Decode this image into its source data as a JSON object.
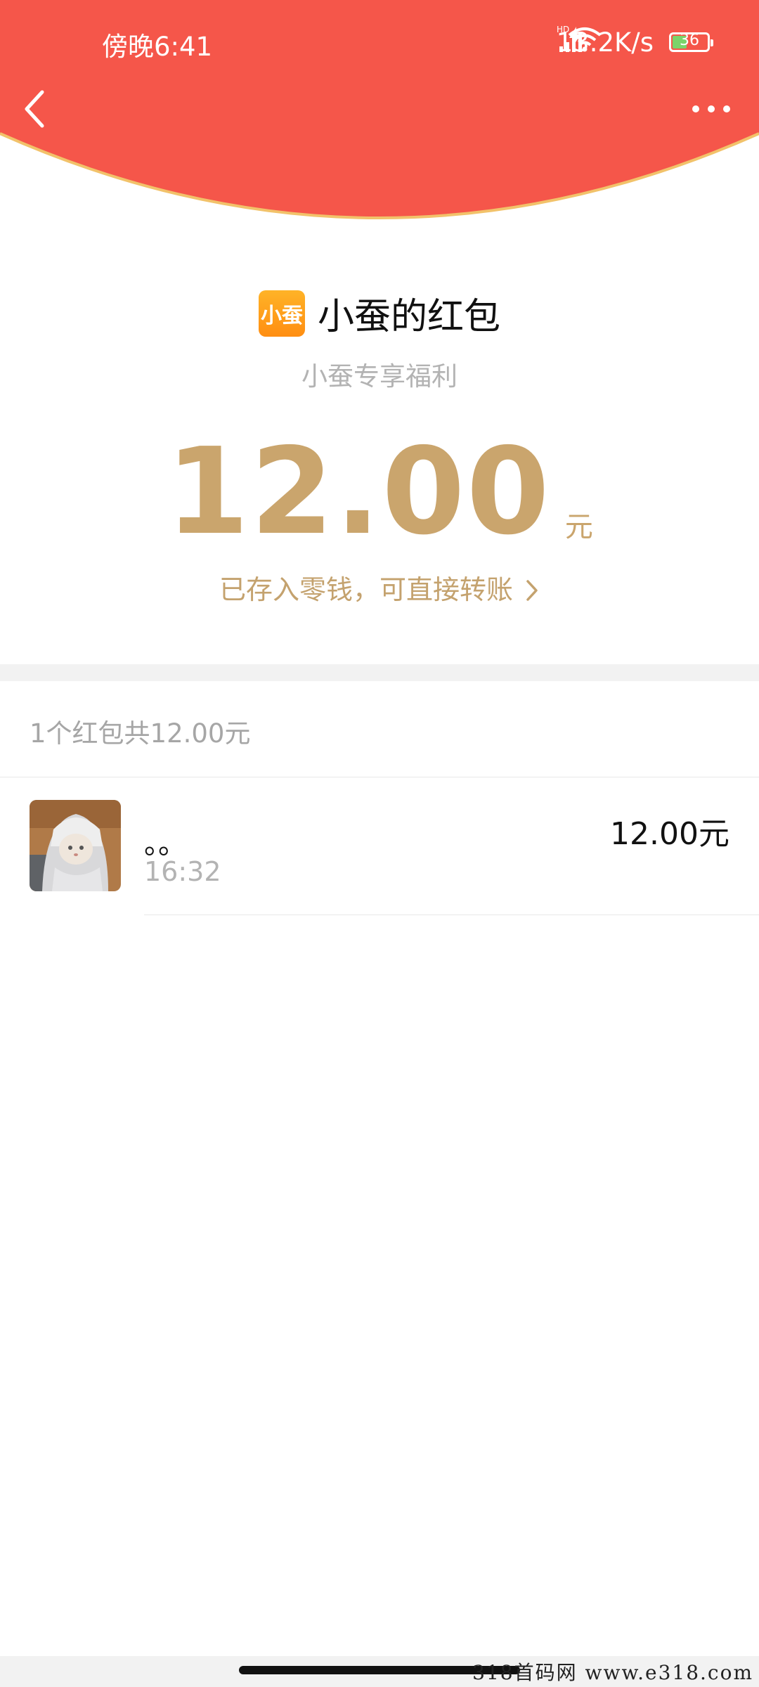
{
  "status_bar": {
    "time": "傍晚6:41",
    "network_speed": "13.2K/s",
    "hd_badge": "HD",
    "battery": "36",
    "icons": [
      "signal-icon",
      "wifi-icon",
      "battery-icon",
      "charging-icon"
    ]
  },
  "nav": {
    "back_icon": "chevron-left-icon",
    "more_icon": "more-dots-icon"
  },
  "sender": {
    "logo_text": "小蚕",
    "title": "小蚕的红包",
    "subtitle": "小蚕专享福利"
  },
  "amount": {
    "value": "12.00",
    "unit": "元",
    "deposit_text": "已存入零钱，可直接转账"
  },
  "summary": {
    "text": "1个红包共12.00元"
  },
  "records": [
    {
      "name": "。。",
      "time": "16:32",
      "amount": "12.00元"
    }
  ],
  "watermark": "318首码网  www.e318.com",
  "colors": {
    "header_red": "#f5564a",
    "gold": "#caa56d",
    "curve_edge": "#f2c26a"
  }
}
